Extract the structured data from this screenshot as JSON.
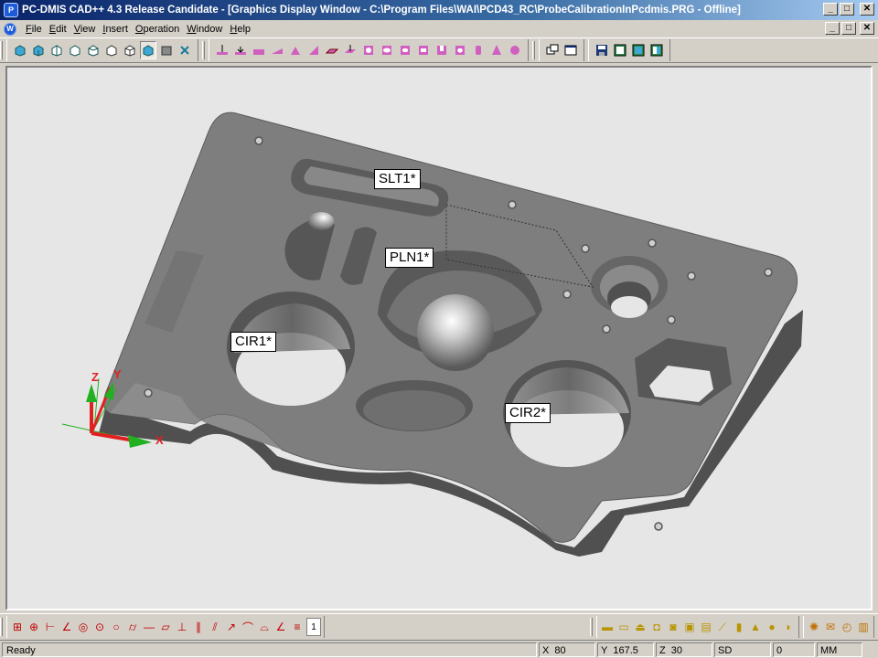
{
  "window": {
    "title": "PC-DMIS CAD++ 4.3 Release Candidate - [Graphics Display Window - C:\\Program Files\\WAI\\PCD43_RC\\ProbeCalibrationInPcdmis.PRG - Offline]",
    "minimize": "_",
    "maximize": "□",
    "close": "✕"
  },
  "menu": [
    "File",
    "Edit",
    "View",
    "Insert",
    "Operation",
    "Window",
    "Help"
  ],
  "features": {
    "slt1": "SLT1*",
    "pln1": "PLN1*",
    "cir1": "CIR1*",
    "cir2": "CIR2*"
  },
  "axes": {
    "x": "X",
    "y": "Y",
    "z": "Z"
  },
  "status": {
    "message": "Ready",
    "x_label": "X",
    "x_value": "80",
    "y_label": "Y",
    "y_value": "167.5",
    "z_label": "Z",
    "z_value": "30",
    "sd_label": "SD",
    "sd_value": "0",
    "units": "MM"
  },
  "colors": {
    "titlebar": "#0a246a",
    "part": "#7e7e7e",
    "viewport_bg": "#e6e6e6",
    "axis_x": "#e02020",
    "axis_y": "#20b020",
    "axis_z": "#20b020"
  }
}
